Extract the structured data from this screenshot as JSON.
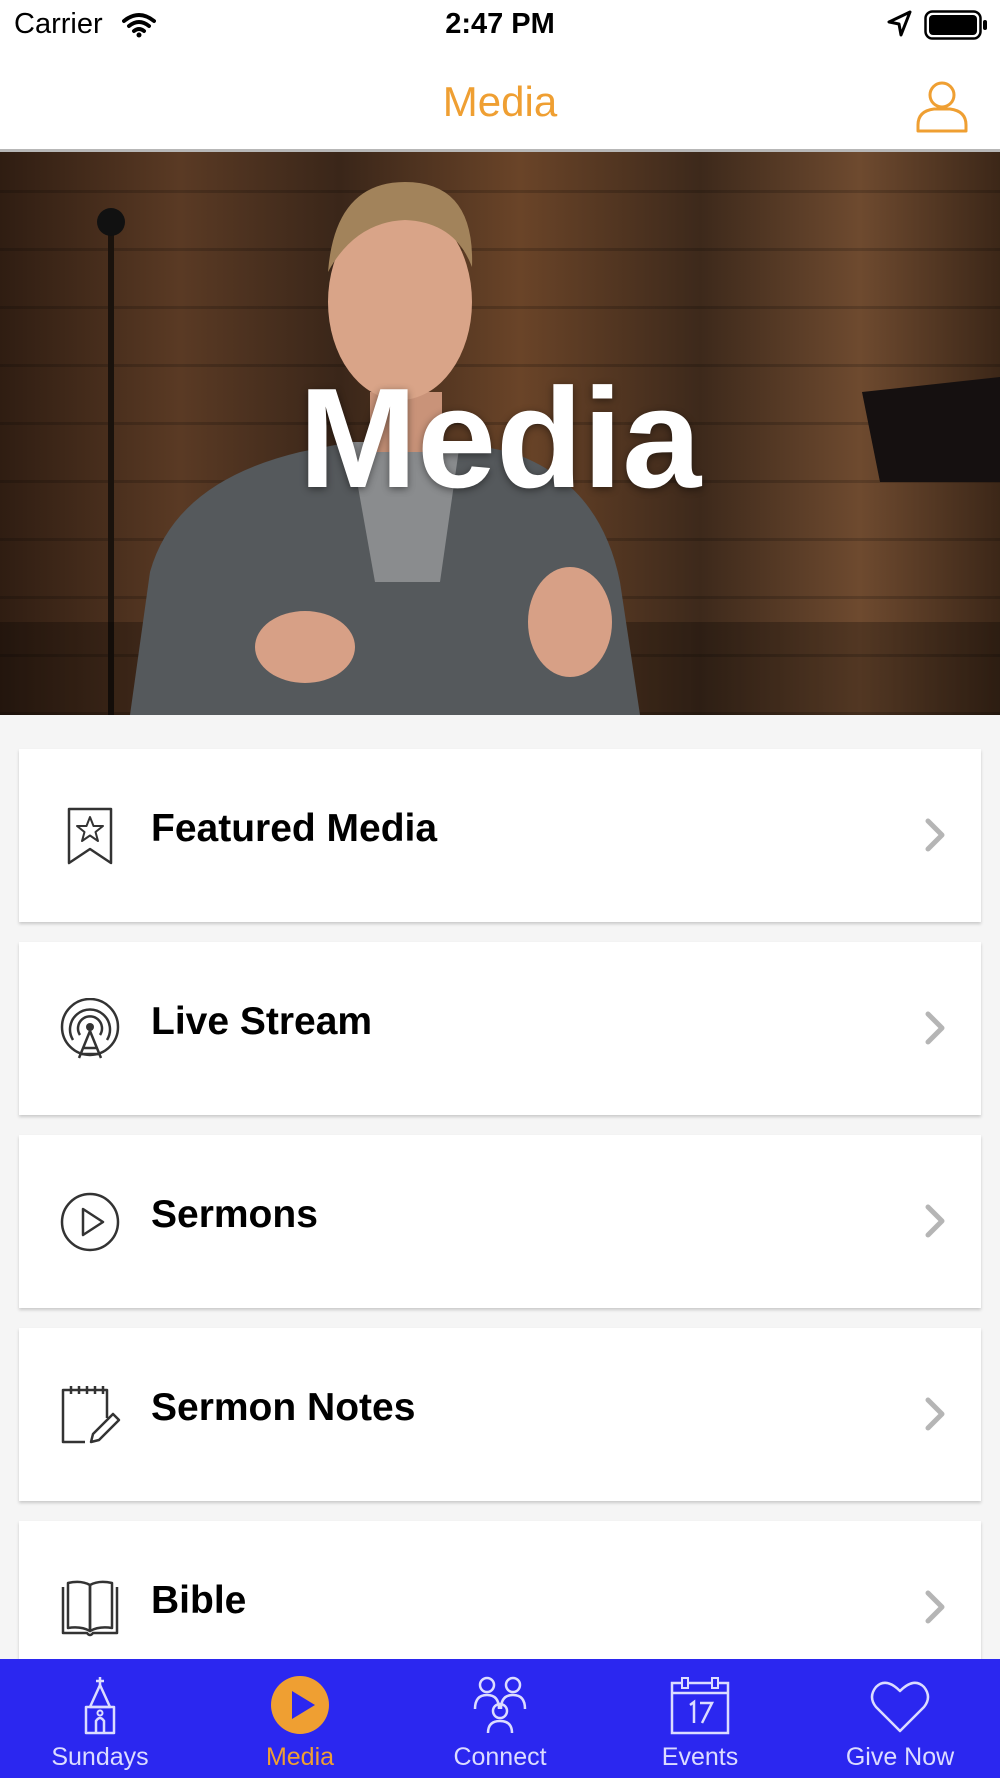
{
  "status_bar": {
    "carrier": "Carrier",
    "time": "2:47 PM"
  },
  "nav": {
    "title": "Media",
    "profile_icon": "user-outline-icon"
  },
  "hero": {
    "title": "Media"
  },
  "menu": [
    {
      "label": "Featured Media",
      "icon": "bookmark-star-icon"
    },
    {
      "label": "Live Stream",
      "icon": "broadcast-tower-icon"
    },
    {
      "label": "Sermons",
      "icon": "play-circle-icon"
    },
    {
      "label": "Sermon Notes",
      "icon": "notes-pencil-icon"
    },
    {
      "label": "Bible",
      "icon": "open-book-icon"
    }
  ],
  "tabs": [
    {
      "label": "Sundays",
      "icon": "church-icon",
      "active": false
    },
    {
      "label": "Media",
      "icon": "play-icon",
      "active": true
    },
    {
      "label": "Connect",
      "icon": "people-group-icon",
      "active": false
    },
    {
      "label": "Events",
      "icon": "calendar-17-icon",
      "active": false
    },
    {
      "label": "Give Now",
      "icon": "heart-icon",
      "active": false
    }
  ],
  "colors": {
    "accent": "#ef9f32",
    "tab_bar": "#2b27f0",
    "background": "#f5f5f5"
  }
}
